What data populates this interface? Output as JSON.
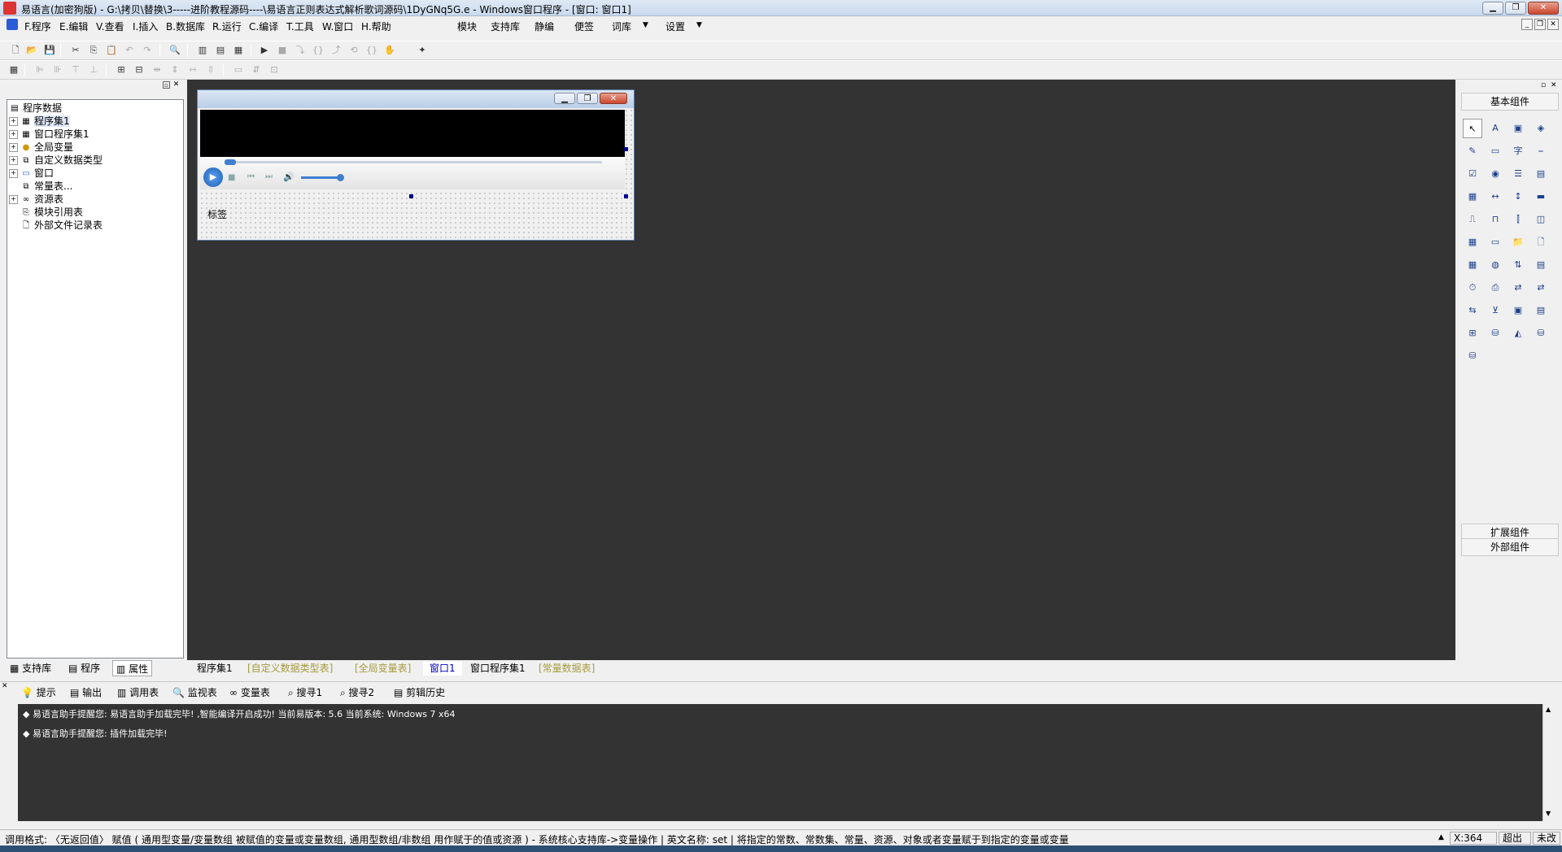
{
  "window": {
    "title": "易语言(加密狗版) - G:\\拷贝\\替换\\3-----进阶教程源码----\\易语言正则表达式解析歌词源码\\1DyGNq5G.e - Windows窗口程序 - [窗口: 窗口1]"
  },
  "menu": {
    "items": [
      "F.程序",
      "E.编辑",
      "V.查看",
      "I.插入",
      "B.数据库",
      "R.运行",
      "C.编译",
      "T.工具",
      "W.窗口",
      "H.帮助"
    ],
    "extra": [
      "模块",
      "支持库",
      "静编",
      "便签",
      "词库",
      "设置"
    ]
  },
  "left_panel": {
    "tree": [
      {
        "label": "程序数据",
        "icon": "folder-icon",
        "expand": ""
      },
      {
        "label": "程序集1",
        "icon": "module-icon",
        "expand": "+"
      },
      {
        "label": "窗口程序集1",
        "icon": "module-icon",
        "expand": "+"
      },
      {
        "label": "全局变量",
        "icon": "variable-icon",
        "expand": "+"
      },
      {
        "label": "自定义数据类型",
        "icon": "type-icon",
        "expand": "+"
      },
      {
        "label": "窗口",
        "icon": "window-icon",
        "expand": "+"
      },
      {
        "label": "常量表...",
        "icon": "constant-icon",
        "expand": ""
      },
      {
        "label": "资源表",
        "icon": "resource-icon",
        "expand": "+"
      },
      {
        "label": "模块引用表",
        "icon": "module-ref-icon",
        "expand": ""
      },
      {
        "label": "外部文件记录表",
        "icon": "file-icon",
        "expand": ""
      }
    ],
    "tabs": [
      "支持库",
      "程序",
      "属性"
    ]
  },
  "designer": {
    "label_text": "标签"
  },
  "editor_tabs": [
    {
      "label": "程序集1",
      "state": "normal"
    },
    {
      "label": "[自定义数据类型表]",
      "state": "inactive"
    },
    {
      "label": "[全局变量表]",
      "state": "inactive"
    },
    {
      "label": "窗口1",
      "state": "active"
    },
    {
      "label": "窗口程序集1",
      "state": "normal"
    },
    {
      "label": "[常量数据表]",
      "state": "inactive"
    }
  ],
  "right_panel": {
    "basic": "基本组件",
    "extended": "扩展组件",
    "external": "外部组件"
  },
  "output_tabs": [
    "提示",
    "输出",
    "调用表",
    "监视表",
    "变量表",
    "搜寻1",
    "搜寻2",
    "剪辑历史"
  ],
  "output_lines": [
    "◆ 易语言助手提醒您: 易语言助手加载完毕! ,智能编译开启成功! 当前易版本: 5.6 当前系统: Windows 7 x64",
    "◆ 易语言助手提醒您: 插件加载完毕!"
  ],
  "status": {
    "text": "调用格式: 〈无返回值〉 赋值 ( 通用型变量/变量数组 被赋值的变量或变量数组, 通用型数组/非数组 用作赋于的值或资源 ) - 系统核心支持库->变量操作 | 英文名称: set | 将指定的常数、常数集、常量、资源、对象或者变量赋于到指定的变量或变量",
    "x": "X:364",
    "mode": "超出",
    "save": "未改"
  }
}
